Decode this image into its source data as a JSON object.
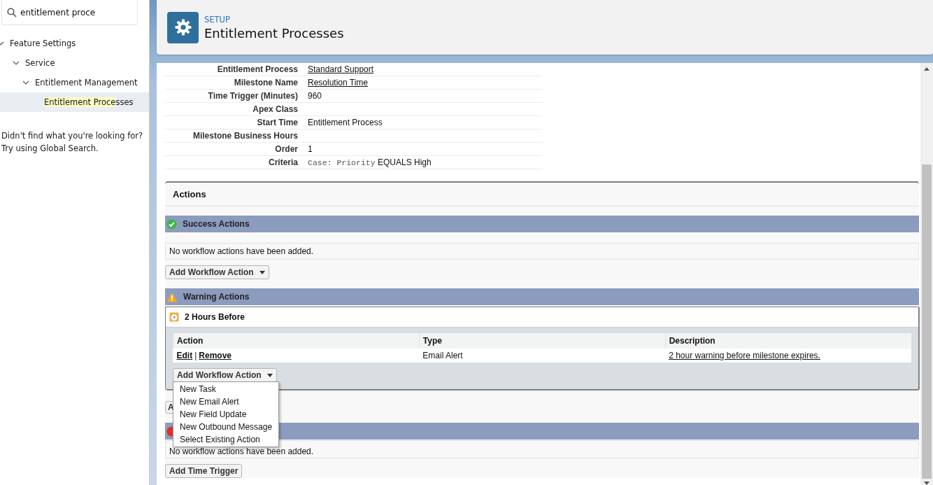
{
  "search": {
    "value": "entitlement proce"
  },
  "tree": [
    {
      "label": "Feature Settings",
      "expanded": true,
      "selected": false,
      "children": [
        {
          "label": "Service",
          "expanded": true,
          "selected": false,
          "children": [
            {
              "label": "Entitlement Management",
              "expanded": true,
              "selected": false,
              "children": [
                {
                  "highlight": "Entitlement Proce",
                  "rest": "sses",
                  "selected": true
                }
              ]
            }
          ]
        }
      ]
    }
  ],
  "help": [
    "Didn't find what you're looking for?",
    "Try using Global Search."
  ],
  "header": {
    "eyebrow": "SETUP",
    "title": "Entitlement Processes"
  },
  "details": [
    {
      "label": "Entitlement Process",
      "value": "Standard Support",
      "kind": "link"
    },
    {
      "label": "Milestone Name",
      "value": "Resolution Time",
      "kind": "link"
    },
    {
      "label": "Time Trigger (Minutes)",
      "value": "960",
      "kind": "text"
    },
    {
      "label": "Apex Class",
      "kind": "empty"
    },
    {
      "label": "Start Time",
      "value": "Entitlement Process",
      "kind": "text"
    },
    {
      "label": "Milestone Business Hours",
      "kind": "empty"
    },
    {
      "label": "Order",
      "value": "1",
      "kind": "text"
    },
    {
      "label": "Criteria",
      "code": "Case: Priority",
      "value": "EQUALS High",
      "kind": "criteria"
    }
  ],
  "actions": {
    "title": "Actions",
    "success": {
      "title": "Success Actions",
      "message": "No workflow actions have been added.",
      "button": "Add Workflow Action"
    },
    "warning": {
      "title": "Warning Actions",
      "trigger": "2 Hours Before",
      "columns": [
        "Action",
        "Type",
        "Description"
      ],
      "rows": [
        {
          "edit": "Edit",
          "separator": "|",
          "remove": "Remove",
          "type": "Email Alert",
          "description": "2 hour warning before milestone expires."
        }
      ],
      "button": "Add Workflow Action",
      "menu_open": true,
      "menu": [
        "New Task",
        "New Email Alert",
        "New Field Update",
        "New Outbound Message",
        "Select Existing Action"
      ],
      "hidden_button": "A"
    },
    "failure": {
      "message": "No workflow actions have been added."
    },
    "time_trigger_button": "Add Time Trigger"
  }
}
